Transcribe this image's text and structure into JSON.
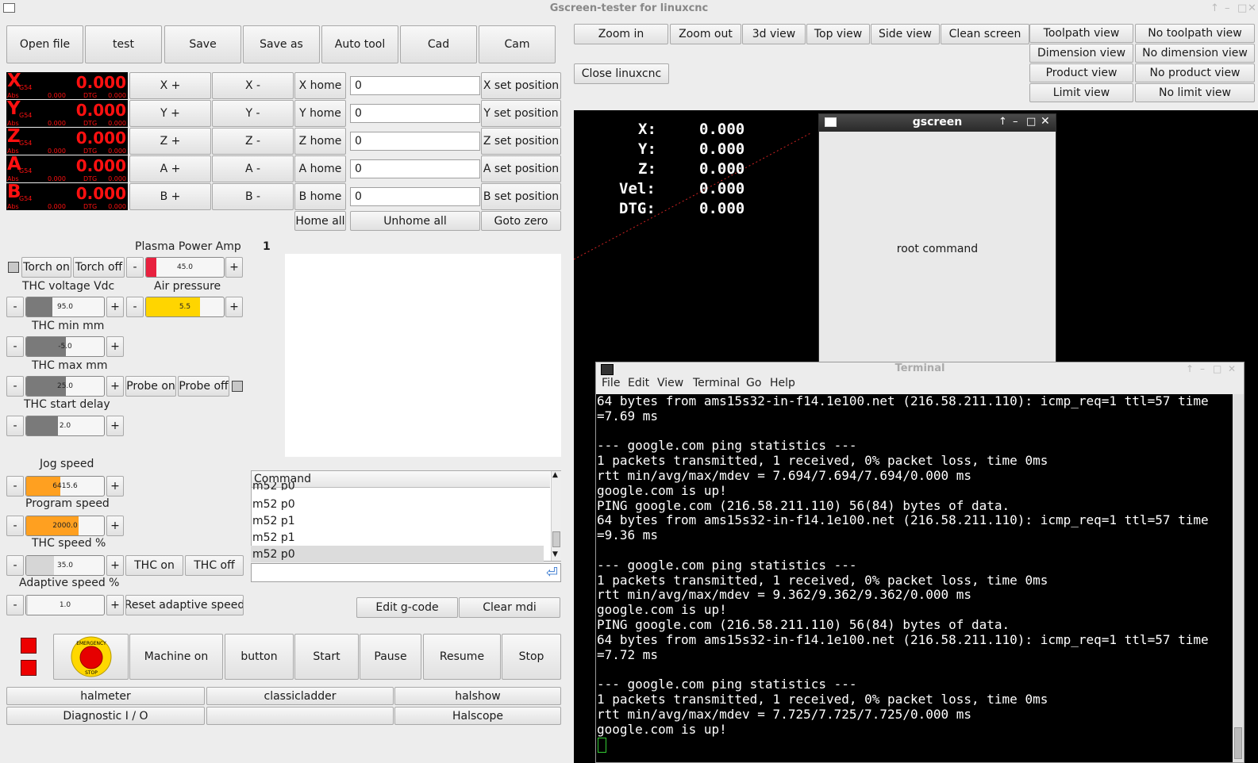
{
  "window": {
    "title": "Gscreen-tester for linuxcnc"
  },
  "toolbar": [
    "Open file",
    "test",
    "Save",
    "Save as",
    "Auto tool",
    "Cad",
    "Cam"
  ],
  "view_buttons": [
    "Zoom in",
    "Zoom out",
    "3d view",
    "Top view",
    "Side view",
    "Clean screen"
  ],
  "close_linuxcnc": "Close linuxcnc",
  "toggle_views": {
    "left": [
      "Toolpath view",
      "Dimension view",
      "Product view",
      "Limit view"
    ],
    "right": [
      "No toolpath view",
      "No dimension view",
      "No product view",
      "No limit view"
    ]
  },
  "dro": {
    "g54": "G54",
    "abs_label": "Abs",
    "dtg_label": "DTG",
    "axes": [
      {
        "axis": "X",
        "value": "0.000",
        "abs": "0.000",
        "dtg": "0.000",
        "plus": "X +",
        "minus": "X -",
        "home": "X home",
        "entry": "0",
        "set": "X set position"
      },
      {
        "axis": "Y",
        "value": "0.000",
        "abs": "0.000",
        "dtg": "0.000",
        "plus": "Y +",
        "minus": "Y -",
        "home": "Y home",
        "entry": "0",
        "set": "Y set position"
      },
      {
        "axis": "Z",
        "value": "0.000",
        "abs": "0.000",
        "dtg": "0.000",
        "plus": "Z +",
        "minus": "Z -",
        "home": "Z home",
        "entry": "0",
        "set": "Z set position"
      },
      {
        "axis": "A",
        "value": "0.000",
        "abs": "0.000",
        "dtg": "0.000",
        "plus": "A +",
        "minus": "A -",
        "home": "A home",
        "entry": "0",
        "set": "A set position"
      },
      {
        "axis": "B",
        "value": "0.000",
        "abs": "0.000",
        "dtg": "0.000",
        "plus": "B +",
        "minus": "B -",
        "home": "B home",
        "entry": "0",
        "set": "B set position"
      }
    ]
  },
  "home_row": {
    "home_all": "Home all",
    "unhome_all": "Unhome all",
    "goto_zero": "Goto zero"
  },
  "plasma": {
    "power_label": "Plasma Power Amp",
    "power_value": "45.0",
    "torch_on": "Torch on",
    "torch_off": "Torch off",
    "thc_voltage_label": "THC voltage Vdc",
    "thc_voltage_value": "95.0",
    "air_label": "Air pressure",
    "air_value": "5.5",
    "thc_min_label": "THC min mm",
    "thc_min_value": "-5.0",
    "thc_max_label": "THC max mm",
    "thc_max_value": "25.0",
    "probe_on": "Probe on",
    "probe_off": "Probe off",
    "thc_delay_label": "THC start delay",
    "thc_delay_value": "2.0",
    "page_number": "1"
  },
  "speeds": {
    "jog_label": "Jog speed",
    "jog_value": "6415.6",
    "program_label": "Program speed",
    "program_value": "2000.0",
    "thc_speed_label": "THC speed %",
    "thc_speed_value": "35.0",
    "thc_on": "THC on",
    "thc_off": "THC off",
    "adaptive_label": "Adaptive speed %",
    "adaptive_value": "1.0",
    "reset_adaptive": "Reset adaptive speed"
  },
  "command_list": {
    "header": "Command",
    "items": [
      "m52 p0",
      "m52 p1",
      "m52 p1",
      "m52 p0"
    ],
    "partial": "m52 p0"
  },
  "mdi": {
    "edit_gcode": "Edit g-code",
    "clear_mdi": "Clear mdi",
    "value": ""
  },
  "estop": {
    "label": "EMERGENCY STOP"
  },
  "machine_buttons": [
    "Machine on",
    "button",
    "Start",
    "Pause",
    "Resume",
    "Stop"
  ],
  "hal_buttons": {
    "row1": [
      "halmeter",
      "classicladder",
      "halshow"
    ],
    "row2": [
      "Diagnostic I / O",
      "",
      "Halscope"
    ]
  },
  "preview_overlay": [
    {
      "label": "X:",
      "value": "0.000"
    },
    {
      "label": "Y:",
      "value": "0.000"
    },
    {
      "label": "Z:",
      "value": "0.000"
    },
    {
      "label": "Vel:",
      "value": "0.000"
    },
    {
      "label": "DTG:",
      "value": "0.000"
    }
  ],
  "gscreen_dialog": {
    "title": "gscreen",
    "body": "root command"
  },
  "terminal": {
    "title": "Terminal",
    "menu": [
      "File",
      "Edit",
      "View",
      "Terminal",
      "Go",
      "Help"
    ],
    "lines": [
      "64 bytes from ams15s32-in-f14.1e100.net (216.58.211.110): icmp_req=1 ttl=57 time",
      "=7.69 ms",
      "",
      "--- google.com ping statistics ---",
      "1 packets transmitted, 1 received, 0% packet loss, time 0ms",
      "rtt min/avg/max/mdev = 7.694/7.694/7.694/0.000 ms",
      "google.com is up!",
      "PING google.com (216.58.211.110) 56(84) bytes of data.",
      "64 bytes from ams15s32-in-f14.1e100.net (216.58.211.110): icmp_req=1 ttl=57 time",
      "=9.36 ms",
      "",
      "--- google.com ping statistics ---",
      "1 packets transmitted, 1 received, 0% packet loss, time 0ms",
      "rtt min/avg/max/mdev = 9.362/9.362/9.362/0.000 ms",
      "google.com is up!",
      "PING google.com (216.58.211.110) 56(84) bytes of data.",
      "64 bytes from ams15s32-in-f14.1e100.net (216.58.211.110): icmp_req=1 ttl=57 time",
      "=7.72 ms",
      "",
      "--- google.com ping statistics ---",
      "1 packets transmitted, 1 received, 0% packet loss, time 0ms",
      "rtt min/avg/max/mdev = 7.725/7.725/7.725/0.000 ms",
      "google.com is up!"
    ]
  },
  "colors": {
    "dro_red": "#ff1010",
    "power_fill": "#e8213f",
    "yellow_fill": "#ffd500",
    "orange_fill": "#ffa020",
    "grey_fill": "#7a7a7a"
  }
}
